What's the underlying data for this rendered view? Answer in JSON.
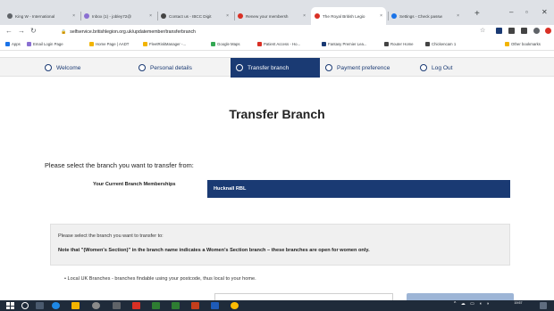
{
  "browser": {
    "tabs": [
      {
        "label": "King W - International",
        "favicon_color": "#5f6368",
        "active": false
      },
      {
        "label": "Inbox (1) - jobley72@",
        "favicon_color": "#8a6fd1",
        "active": false
      },
      {
        "label": "Contact us - IBCC Digit",
        "favicon_color": "#444444",
        "active": false
      },
      {
        "label": "Renew your membersh",
        "favicon_color": "#d93025",
        "active": false
      },
      {
        "label": "The Royal British Legio",
        "favicon_color": "#d93025",
        "active": true
      },
      {
        "label": "Settings - Check passw",
        "favicon_color": "#1a73e8",
        "active": false
      }
    ],
    "new_tab": "+",
    "window_controls": {
      "minimize": "–",
      "maximize": "▫",
      "close": "✕"
    },
    "url": "selfservice.britishlegion.org.uk/updatemember/transferbranch",
    "bookmarks": [
      {
        "label": "Apps",
        "color": "#1a73e8"
      },
      {
        "label": "Email Login Page",
        "color": "#8a6fd1"
      },
      {
        "label": "Home Page | AADT",
        "color": "#f2b400"
      },
      {
        "label": "FleetRiskManager -...",
        "color": "#f2b400"
      },
      {
        "label": "Google Maps",
        "color": "#34a853"
      },
      {
        "label": "Patient Access - Ho...",
        "color": "#d93025"
      },
      {
        "label": "Fantasy Premier Lea...",
        "color": "#1a3a73"
      },
      {
        "label": "Router Home",
        "color": "#444444"
      },
      {
        "label": "Chickencam 1",
        "color": "#444444"
      }
    ],
    "other_bookmarks": "Other bookmarks"
  },
  "steps": [
    {
      "label": "Welcome",
      "active": false
    },
    {
      "label": "Personal details",
      "active": false
    },
    {
      "label": "Transfer branch",
      "active": true
    },
    {
      "label": "Payment preference",
      "active": false
    },
    {
      "label": "Log Out",
      "active": false
    }
  ],
  "page": {
    "title": "Transfer Branch",
    "prompt": "Please select the branch you want to transfer from:",
    "current_label": "Your Current Branch Memberships",
    "current_branch": "Hucknall RBL",
    "info_line1": "Please select the branch you want to transfer to:",
    "info_line2": "Note that \"(Women's Section)\" in the branch name indicates a Women's Section branch – these branches are open for women only.",
    "bullet": "• Local UK Branches - branches findable using your postcode, thus local to your home."
  },
  "colors": {
    "brand_navy": "#1a3a73",
    "taskbar": "#1f2b3a"
  },
  "taskbar": {
    "clock_time": "19:57"
  }
}
